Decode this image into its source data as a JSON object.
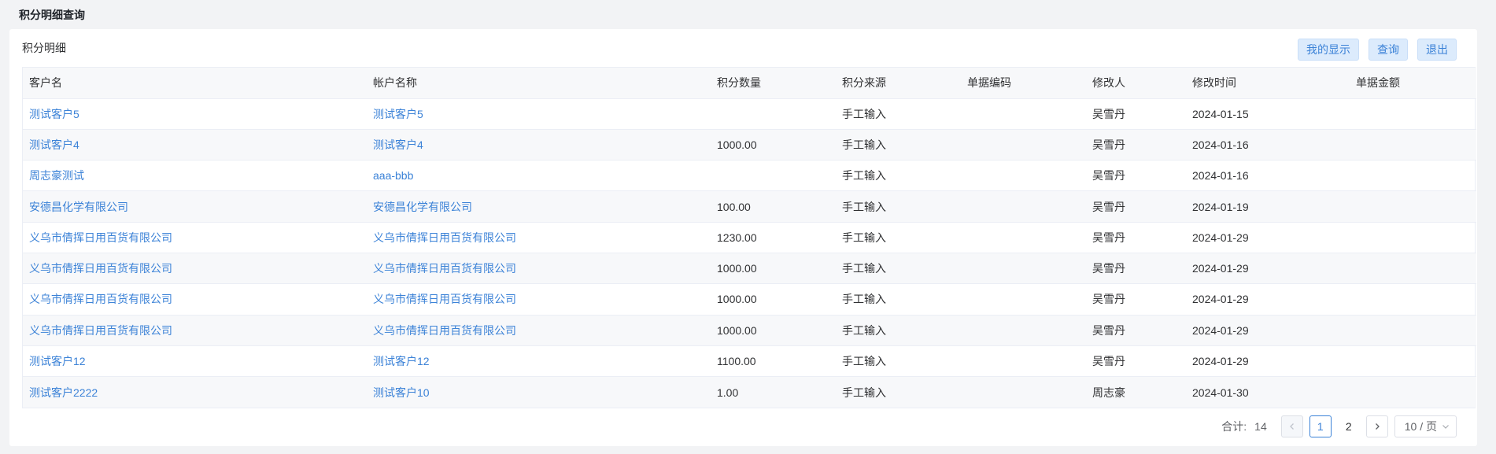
{
  "page": {
    "title": "积分明细查询"
  },
  "card": {
    "title": "积分明细"
  },
  "toolbar": {
    "display_label": "我的显示",
    "query_label": "查询",
    "exit_label": "退出"
  },
  "table": {
    "columns": [
      "客户名",
      "帐户名称",
      "积分数量",
      "积分来源",
      "单据编码",
      "修改人",
      "修改时间",
      "单据金额"
    ],
    "rows": [
      {
        "customer": "测试客户5",
        "account": "测试客户5",
        "points": "",
        "source": "手工输入",
        "doc_code": "",
        "modifier": "吴雪丹",
        "modified_time": "2024-01-15",
        "doc_amount": ""
      },
      {
        "customer": "测试客户4",
        "account": "测试客户4",
        "points": "1000.00",
        "source": "手工输入",
        "doc_code": "",
        "modifier": "吴雪丹",
        "modified_time": "2024-01-16",
        "doc_amount": ""
      },
      {
        "customer": "周志豪测试",
        "account": "aaa-bbb",
        "points": "",
        "source": "手工输入",
        "doc_code": "",
        "modifier": "吴雪丹",
        "modified_time": "2024-01-16",
        "doc_amount": ""
      },
      {
        "customer": "安德昌化学有限公司",
        "account": "安德昌化学有限公司",
        "points": "100.00",
        "source": "手工输入",
        "doc_code": "",
        "modifier": "吴雪丹",
        "modified_time": "2024-01-19",
        "doc_amount": ""
      },
      {
        "customer": "义乌市倩挥日用百货有限公司",
        "account": "义乌市倩挥日用百货有限公司",
        "points": "1230.00",
        "source": "手工输入",
        "doc_code": "",
        "modifier": "吴雪丹",
        "modified_time": "2024-01-29",
        "doc_amount": ""
      },
      {
        "customer": "义乌市倩挥日用百货有限公司",
        "account": "义乌市倩挥日用百货有限公司",
        "points": "1000.00",
        "source": "手工输入",
        "doc_code": "",
        "modifier": "吴雪丹",
        "modified_time": "2024-01-29",
        "doc_amount": ""
      },
      {
        "customer": "义乌市倩挥日用百货有限公司",
        "account": "义乌市倩挥日用百货有限公司",
        "points": "1000.00",
        "source": "手工输入",
        "doc_code": "",
        "modifier": "吴雪丹",
        "modified_time": "2024-01-29",
        "doc_amount": ""
      },
      {
        "customer": "义乌市倩挥日用百货有限公司",
        "account": "义乌市倩挥日用百货有限公司",
        "points": "1000.00",
        "source": "手工输入",
        "doc_code": "",
        "modifier": "吴雪丹",
        "modified_time": "2024-01-29",
        "doc_amount": ""
      },
      {
        "customer": "测试客户12",
        "account": "测试客户12",
        "points": "1100.00",
        "source": "手工输入",
        "doc_code": "",
        "modifier": "吴雪丹",
        "modified_time": "2024-01-29",
        "doc_amount": ""
      },
      {
        "customer": "测试客户2222",
        "account": "测试客户10",
        "points": "1.00",
        "source": "手工输入",
        "doc_code": "",
        "modifier": "周志豪",
        "modified_time": "2024-01-30",
        "doc_amount": ""
      }
    ]
  },
  "pagination": {
    "total_label": "合计:",
    "total": "14",
    "pages": [
      "1",
      "2"
    ],
    "current": "1",
    "page_size": "10 / 页",
    "icons": {
      "prev": "chevron-left-icon",
      "next": "chevron-right-icon",
      "size_dropdown": "chevron-down-icon"
    }
  },
  "colors": {
    "accent": "#3b82d7",
    "button_bg": "#dcebfc",
    "page_bg": "#f2f3f5",
    "stripe": "#f7f8fa"
  }
}
